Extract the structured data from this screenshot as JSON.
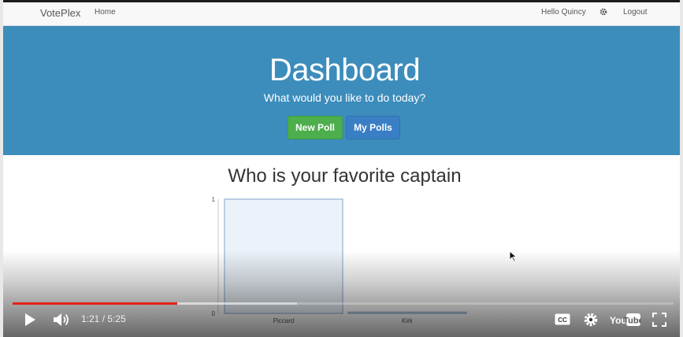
{
  "navbar": {
    "brand": "VotePlex",
    "home_label": "Home",
    "greeting": "Hello Quincy",
    "settings_icon": "gear-icon",
    "logout_label": "Logout"
  },
  "jumbotron": {
    "title": "Dashboard",
    "subtitle": "What would you like to do today?",
    "new_poll_label": "New Poll",
    "my_polls_label": "My Polls"
  },
  "poll": {
    "title": "Who is your favorite captain"
  },
  "chart_data": {
    "type": "bar",
    "categories": [
      "Piccard",
      "Kirk"
    ],
    "values": [
      1,
      0
    ],
    "ylim": [
      0,
      1
    ],
    "yticks": [
      0,
      1
    ],
    "grid": false,
    "bar_fill": "#ebf2f9",
    "bar_stroke": "#a7c1da"
  },
  "video_player": {
    "current_time": "1:21",
    "separator": "/",
    "duration": "5:25",
    "progress": 0.249,
    "buffered": 0.43,
    "icons": [
      "play-icon",
      "volume-icon",
      "captions-icon",
      "settings-icon",
      "youtube-logo",
      "fullscreen-icon"
    ],
    "accent_color": "#e62117"
  }
}
